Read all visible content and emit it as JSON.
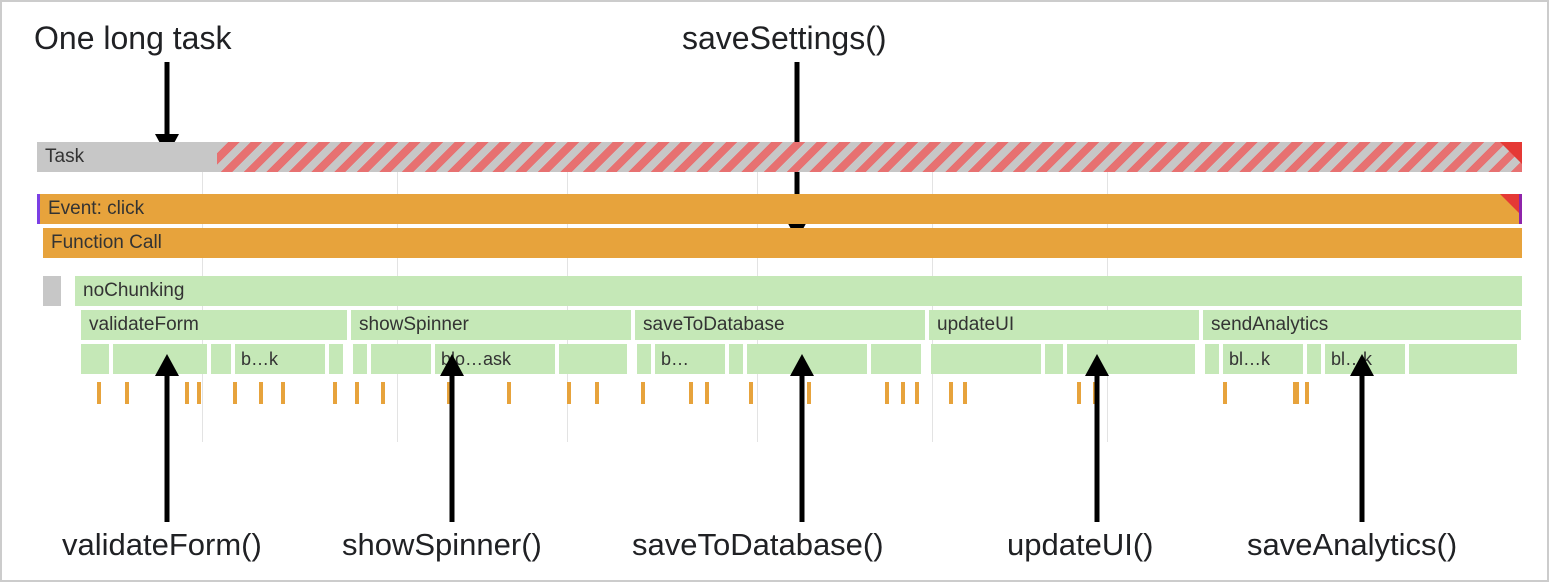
{
  "annotations": {
    "top_left": "One long task",
    "top_right": "saveSettings()",
    "bottom": {
      "validate": "validateForm()",
      "spinner": "showSpinner()",
      "database": "saveToDatabase()",
      "updateui": "updateUI()",
      "analytics": "saveAnalytics()"
    }
  },
  "rows": {
    "task": "Task",
    "event": "Event: click",
    "func": "Function Call",
    "nochunk": "noChunking",
    "children": {
      "validate": "validateForm",
      "spinner": "showSpinner",
      "database": "saveToDatabase",
      "updateui": "updateUI",
      "analytics": "sendAnalytics"
    },
    "segLabels": {
      "bk": "b…k",
      "bloask": "blo…ask",
      "b": "b…",
      "blk1": "bl…k",
      "blk2": "bl…k"
    }
  }
}
